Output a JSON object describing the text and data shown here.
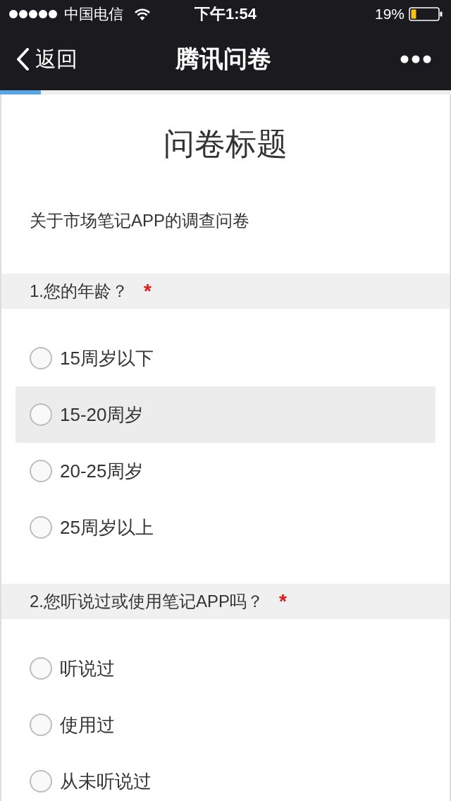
{
  "status_bar": {
    "carrier": "中国电信",
    "time": "下午1:54",
    "battery": "19%"
  },
  "nav_bar": {
    "back": "返回",
    "title": "腾讯问卷"
  },
  "progress": {
    "level": 0.09
  },
  "survey": {
    "title": "问卷标题",
    "description": "关于市场笔记APP的调查问卷"
  },
  "questions": [
    {
      "label": "1.您的年龄？",
      "required_mark": "*",
      "options": [
        {
          "label": "15周岁以下",
          "selected": false,
          "highlighted": false
        },
        {
          "label": "15-20周岁",
          "selected": false,
          "highlighted": true
        },
        {
          "label": "20-25周岁",
          "selected": false,
          "highlighted": false
        },
        {
          "label": "25周岁以上",
          "selected": false,
          "highlighted": false
        }
      ]
    },
    {
      "label": "2.您听说过或使用笔记APP吗？",
      "required_mark": "*",
      "options": [
        {
          "label": "听说过",
          "selected": false,
          "highlighted": false
        },
        {
          "label": "使用过",
          "selected": false,
          "highlighted": false
        },
        {
          "label": "从未听说过",
          "selected": false,
          "highlighted": false
        }
      ]
    }
  ]
}
